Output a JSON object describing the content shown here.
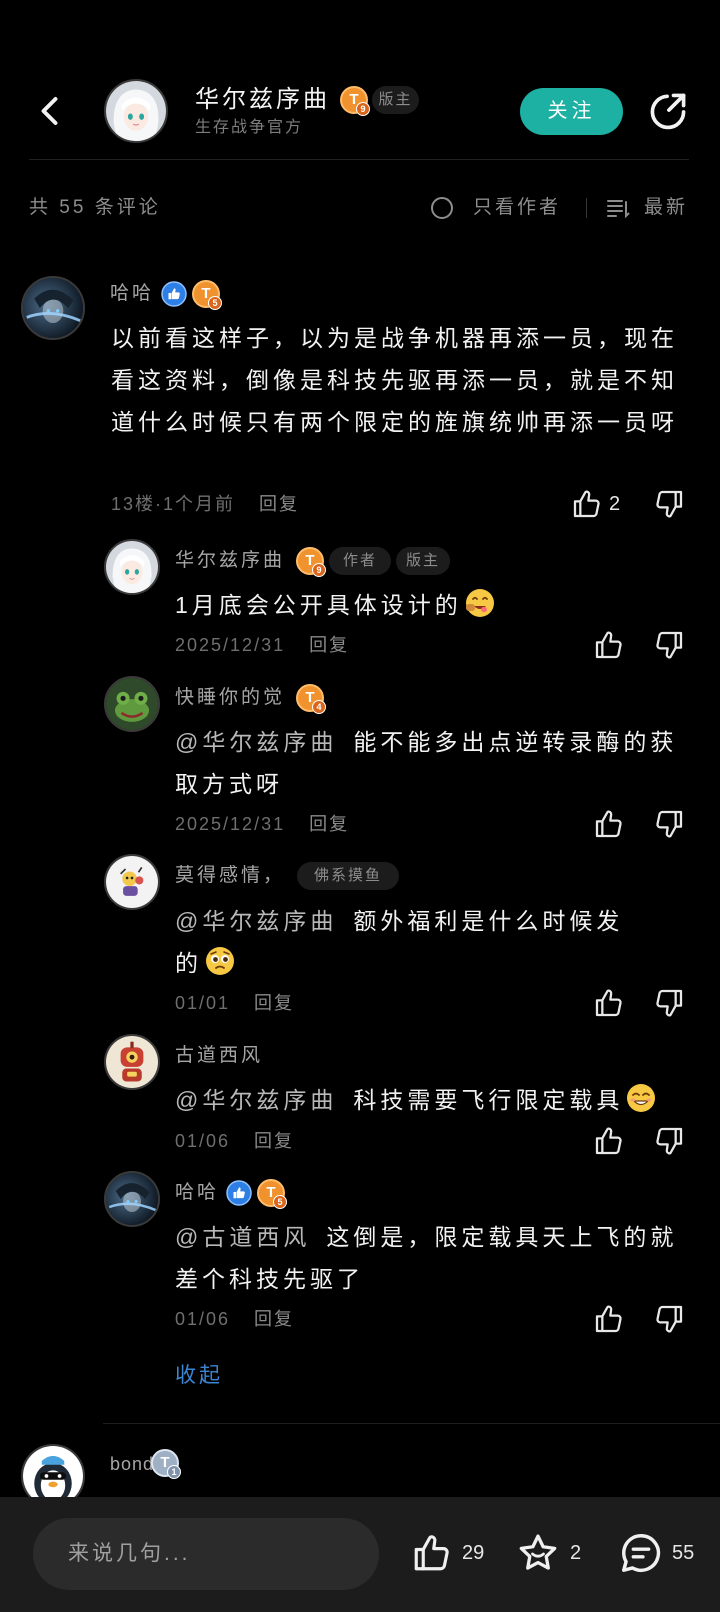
{
  "header": {
    "title": "华尔兹序曲",
    "badge": {
      "letter": "T",
      "level": "9"
    },
    "role_tag": "版主",
    "subtitle": "生存战争官方",
    "follow_label": "关注"
  },
  "toolbar": {
    "count_label": "共 55 条评论",
    "author_only_label": "只看作者",
    "sort_label": "最新"
  },
  "main_comment": {
    "user": "哈哈",
    "badge": {
      "letter": "T",
      "level": "5"
    },
    "text": "以前看这样子，以为是战争机器再添一员，现在看这资料，倒像是科技先驱再添一员，就是不知道什么时候只有两个限定的旌旗统帅再添一员呀",
    "meta": "13楼·1个月前",
    "reply_label": "回复",
    "likes": "2"
  },
  "replies": [
    {
      "user": "华尔兹序曲",
      "badge": {
        "letter": "T",
        "level": "9"
      },
      "tags": [
        "作者",
        "版主"
      ],
      "text": "1月底会公开具体设计的",
      "emoji": "emoji-yummy-face",
      "date": "2025/12/31",
      "reply_label": "回复"
    },
    {
      "user": "快睡你的觉",
      "badge": {
        "letter": "T",
        "level": "4"
      },
      "mention": "@华尔兹序曲",
      "text": "能不能多出点逆转录酶的获取方式呀",
      "date": "2025/12/31",
      "reply_label": "回复"
    },
    {
      "user": "莫得感情，",
      "tags": [
        "佛系摸鱼"
      ],
      "mention": "@华尔兹序曲",
      "text": "额外福利是什么时候发的",
      "emoji": "emoji-pleading-face",
      "date": "01/01",
      "reply_label": "回复"
    },
    {
      "user": "古道西风",
      "mention": "@华尔兹序曲",
      "text": "科技需要飞行限定载具",
      "emoji": "emoji-smirking-face",
      "date": "01/06",
      "reply_label": "回复"
    },
    {
      "user": "哈哈",
      "badge": {
        "letter": "T",
        "level": "5"
      },
      "mention": "@古道西风",
      "text": "这倒是，限定载具天上飞的就差个科技先驱了",
      "date": "01/06",
      "reply_label": "回复"
    }
  ],
  "collapse_label": "收起",
  "next_comment": {
    "user": "bond",
    "badge": {
      "letter": "T",
      "level": "1"
    }
  },
  "bottom_bar": {
    "placeholder": "来说几句...",
    "likes": "29",
    "favorites": "2",
    "comments": "55"
  },
  "icons": {
    "back": "chevron-left-icon",
    "share": "share-icon",
    "radio": "radio-circle-icon",
    "sort": "sort-list-icon",
    "like": "thumbs-up-icon",
    "dislike": "thumbs-down-icon",
    "verified": "verified-thumb-icon",
    "favorite": "star-icon",
    "comment": "chat-bubble-icon"
  },
  "colors": {
    "background": "#000000",
    "accent": "#1cb1a3",
    "link": "#3b86d3",
    "level_badge": "#f0922e",
    "verified": "#2d7fe6"
  }
}
